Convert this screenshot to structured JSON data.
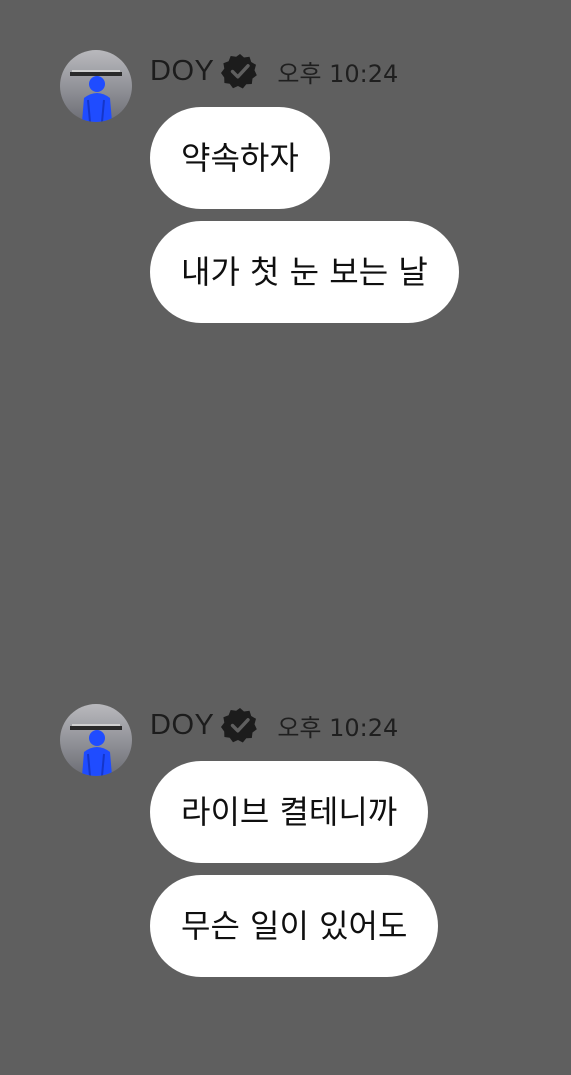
{
  "messages": [
    {
      "sender": "DOY",
      "time": "오후 10:24",
      "avatar_icon": "profile-photo",
      "badge_icon": "verified-badge-icon",
      "texts": [
        "약속하자",
        "내가 첫 눈 보는 날"
      ]
    },
    {
      "sender": "DOY",
      "time": "오후 10:24",
      "avatar_icon": "profile-photo",
      "badge_icon": "verified-badge-icon",
      "texts": [
        "라이브 켤테니까",
        "무슨 일이 있어도"
      ]
    }
  ],
  "colors": {
    "background": "#5f5f5f",
    "bubble": "#ffffff",
    "text": "#1c1c1c",
    "avatar_accent": "#1f4cff"
  }
}
